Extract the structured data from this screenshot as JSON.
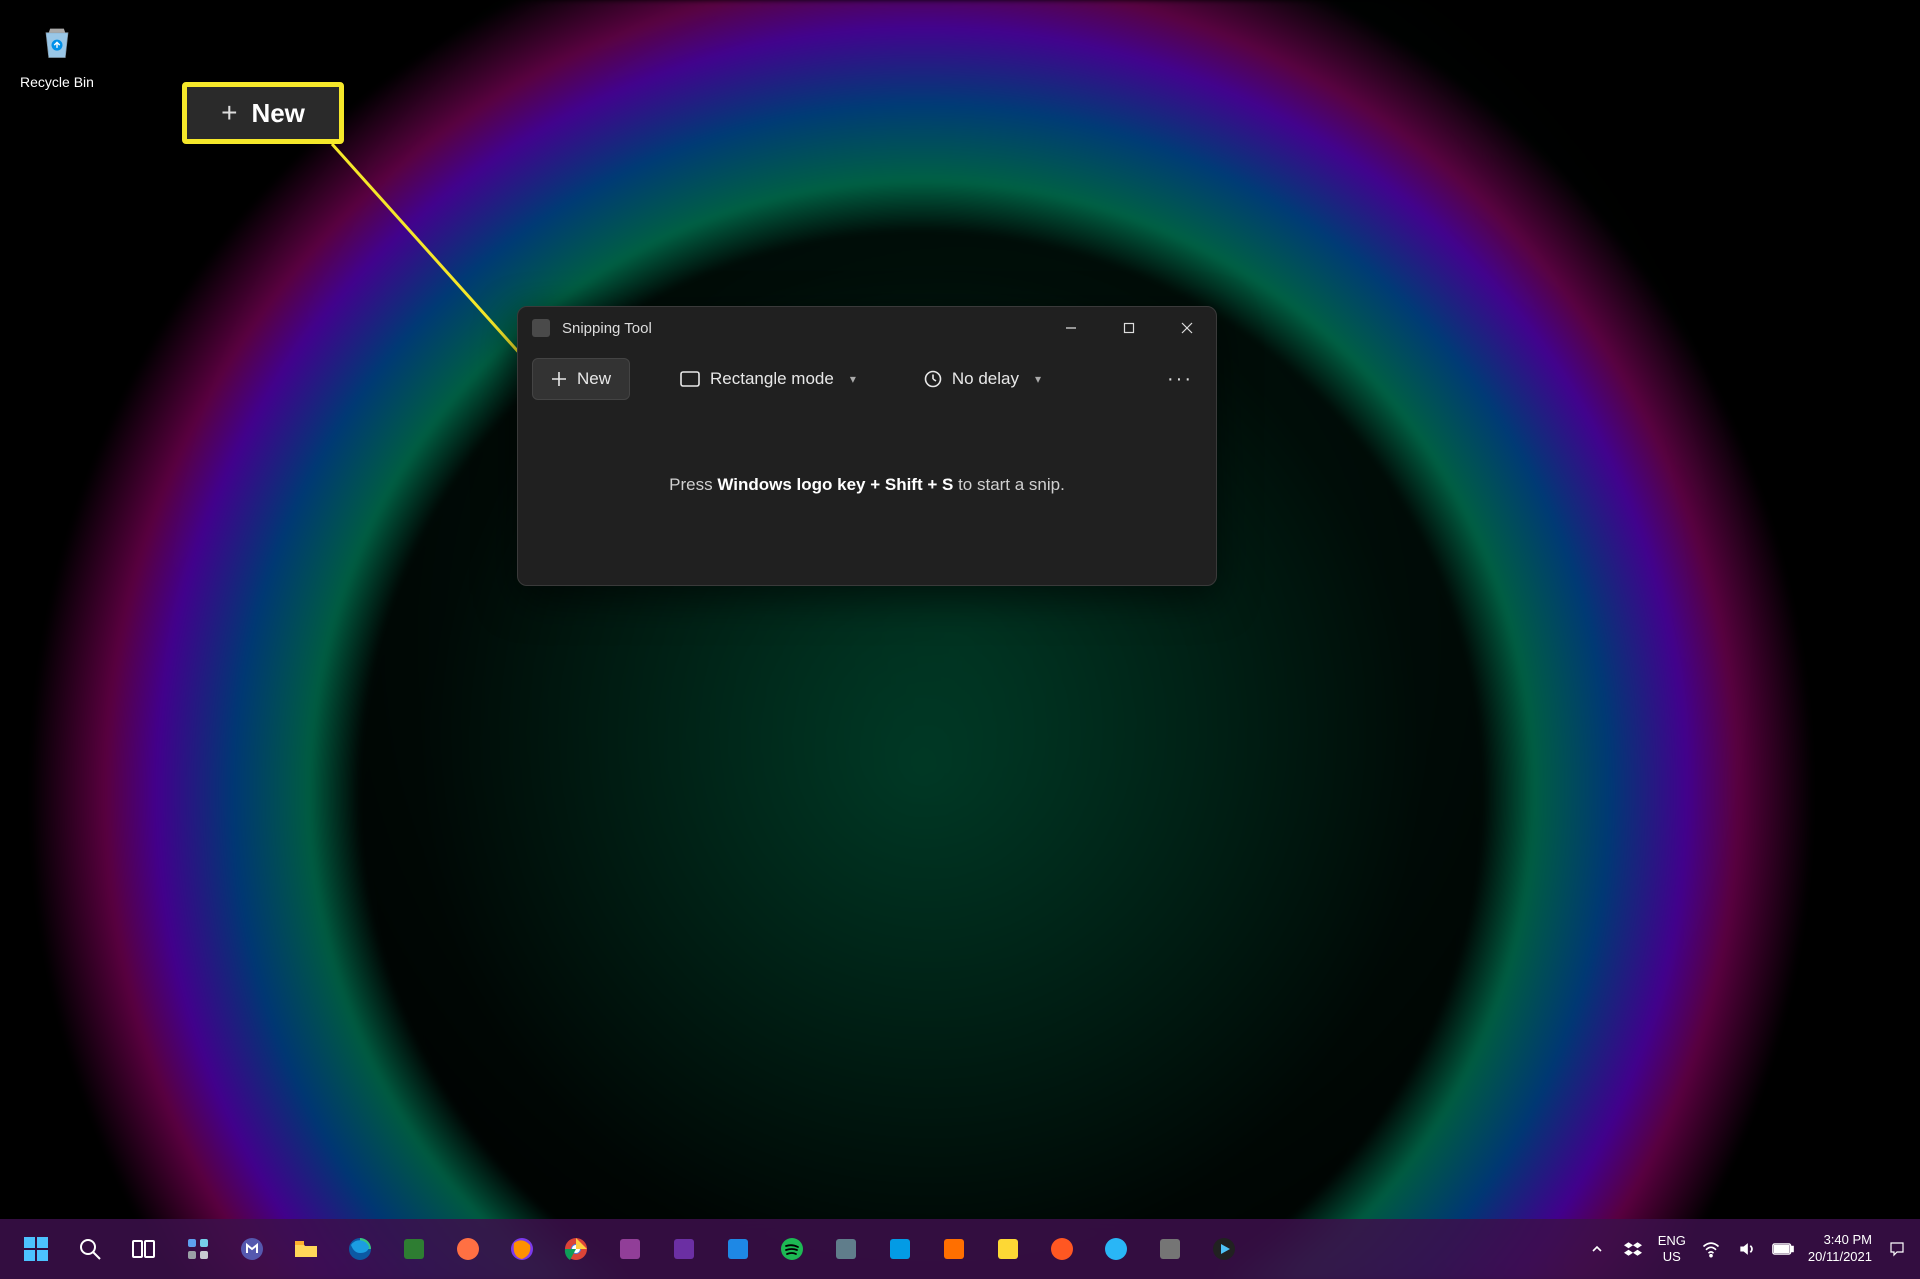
{
  "desktop": {
    "recycle_bin_label": "Recycle Bin"
  },
  "window": {
    "title": "Snipping Tool",
    "new_label": "New",
    "mode_label": "Rectangle mode",
    "delay_label": "No delay",
    "hint_prefix": "Press ",
    "hint_keys": "Windows logo key + Shift + S",
    "hint_suffix": " to start a snip."
  },
  "callout": {
    "label": "New"
  },
  "taskbar": {
    "lang_code": "ENG",
    "lang_region": "US",
    "time": "3:40 PM",
    "date": "20/11/2021"
  },
  "colors": {
    "highlight": "#f5e72a",
    "window_bg": "#202020",
    "taskbar_bg": "rgba(60,15,75,0.85)"
  }
}
